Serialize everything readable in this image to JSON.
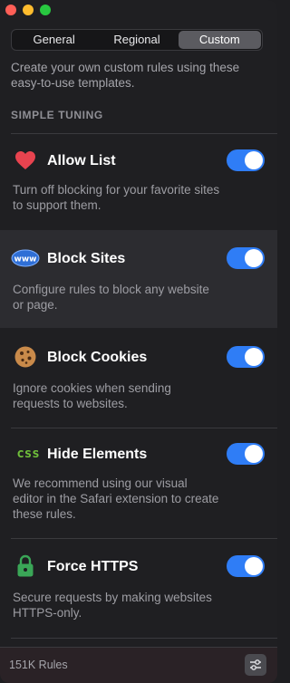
{
  "tabs": [
    {
      "label": "General",
      "active": false
    },
    {
      "label": "Regional",
      "active": false
    },
    {
      "label": "Custom",
      "active": true
    }
  ],
  "intro": "Create your own custom rules using these easy-to-use templates.",
  "section_title": "SIMPLE TUNING",
  "rules": [
    {
      "icon": "heart-icon",
      "label": "Allow List",
      "description": "Turn off blocking for your favorite sites to support them.",
      "enabled": true
    },
    {
      "icon": "globe-www-icon",
      "icon_text": "www",
      "label": "Block Sites",
      "description": "Configure rules to block any website or page.",
      "enabled": true
    },
    {
      "icon": "cookie-icon",
      "label": "Block Cookies",
      "description": "Ignore cookies when sending requests to websites.",
      "enabled": true
    },
    {
      "icon": "css-icon",
      "icon_text": "css",
      "label": "Hide Elements",
      "description": "We recommend using our visual editor in the Safari extension to create these rules.",
      "enabled": true
    },
    {
      "icon": "lock-icon",
      "label": "Force HTTPS",
      "description": "Secure requests by making websites HTTPS-only.",
      "enabled": true
    }
  ],
  "footer": {
    "rule_count": "151K Rules",
    "settings_icon": "sliders-icon"
  },
  "colors": {
    "toggle_on": "#2f7df6",
    "heart": "#e8434f",
    "css": "#6fbf3a",
    "lock": "#3aa657"
  }
}
